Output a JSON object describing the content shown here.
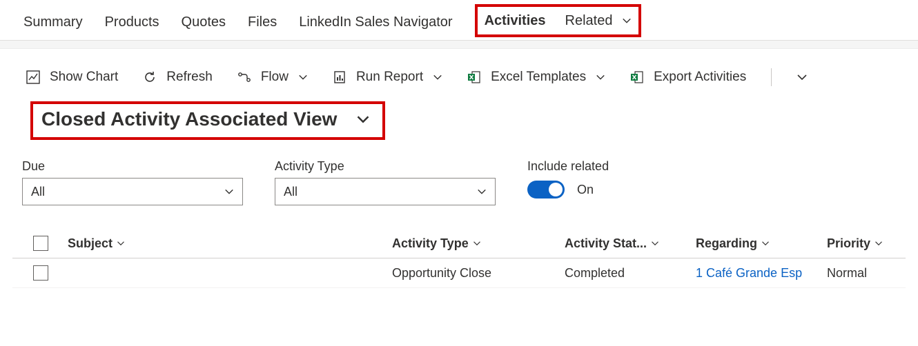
{
  "tabs": {
    "summary": "Summary",
    "products": "Products",
    "quotes": "Quotes",
    "files": "Files",
    "linkedin": "LinkedIn Sales Navigator",
    "activities": "Activities",
    "related": "Related"
  },
  "commands": {
    "show_chart": "Show Chart",
    "refresh": "Refresh",
    "flow": "Flow",
    "run_report": "Run Report",
    "excel_templates": "Excel Templates",
    "export_activities": "Export Activities"
  },
  "view": {
    "title": "Closed Activity Associated View"
  },
  "filters": {
    "due_label": "Due",
    "due_value": "All",
    "activity_type_label": "Activity Type",
    "activity_type_value": "All",
    "include_related_label": "Include related",
    "include_related_value": "On"
  },
  "columns": {
    "subject": "Subject",
    "activity_type": "Activity Type",
    "activity_status": "Activity Stat...",
    "regarding": "Regarding",
    "priority": "Priority"
  },
  "rows": [
    {
      "subject": "",
      "activity_type": "Opportunity Close",
      "activity_status": "Completed",
      "regarding": "1 Café Grande Esp",
      "priority": "Normal"
    }
  ]
}
